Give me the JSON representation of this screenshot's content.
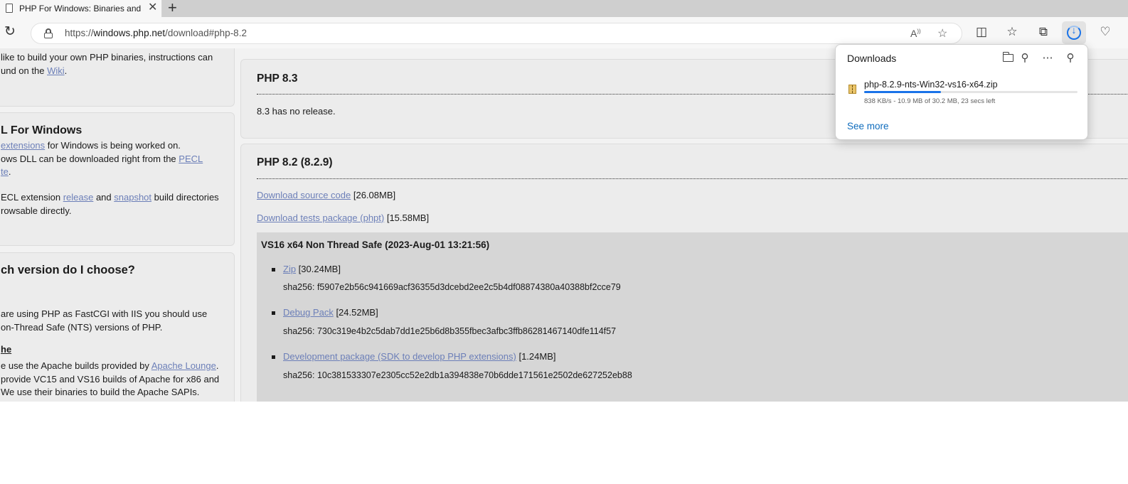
{
  "browser": {
    "tab": {
      "title": "PHP For Windows: Binaries and s",
      "close": "✕"
    },
    "new_tab": "+",
    "url": {
      "prefix": "https://",
      "host": "windows.php.net",
      "path": "/download#php-8.2"
    }
  },
  "downloads_flyout": {
    "title": "Downloads",
    "item": {
      "filename": "php-8.2.9-nts-Win32-vs16-x64.zip",
      "progress": 0.36,
      "status": "838 KB/s - 10.9 MB of 30.2 MB, 23 secs left"
    },
    "see_more": "See more"
  },
  "sidebar": {
    "build": {
      "line1": "like to build your own PHP binaries, instructions can",
      "line2_pre": "und on the ",
      "line2_link": "Wiki",
      "line2_post": "."
    },
    "pecl": {
      "title": "L For Windows",
      "line1_link": "extensions",
      "line1_post": " for Windows is being worked on.",
      "line2_pre": "ows DLL can be downloaded right from the ",
      "line2_link": "PECL",
      "line3_link": "te",
      "line3_post": ".",
      "line4_pre": "ECL extension ",
      "line4_link1": "release",
      "line4_mid": " and ",
      "line4_link2": "snapshot",
      "line4_post": " build directories",
      "line5": "rowsable directly."
    },
    "which": {
      "title": "ch version do I choose?",
      "line1": "are using PHP as FastCGI with IIS you should use",
      "line2": "on-Thread Safe (NTS) versions of PHP.",
      "apache_heading": "he",
      "line3_pre": "e use the Apache builds provided by ",
      "line3_link": "Apache Lounge",
      "line3_post": ".",
      "line4": "provide VC15 and VS16 builds of Apache for x86 and",
      "line5": "We use their binaries to build the Apache SAPIs."
    }
  },
  "main": {
    "php83": {
      "heading": "PHP 8.3",
      "text": "8.3 has no release."
    },
    "php82": {
      "heading": "PHP 8.2 (8.2.9)",
      "source_link": "Download source code",
      "source_size": " [26.08MB]",
      "tests_link": "Download tests package (phpt)",
      "tests_size": " [15.58MB]",
      "build_title": "VS16 x64 Non Thread Safe (2023-Aug-01 13:21:56)",
      "files": [
        {
          "link": "Zip",
          "size": " [30.24MB]",
          "sha": "sha256: f5907e2b56c941669acf36355d3dcebd2ee2c5b4df08874380a40388bf2cce79"
        },
        {
          "link": "Debug Pack",
          "size": " [24.52MB]",
          "sha": "sha256: 730c319e4b2c5dab7dd1e25b6d8b355fbec3afbc3ffb86281467140dfe114f57"
        },
        {
          "link": "Development package (SDK to develop PHP extensions)",
          "size": " [1.24MB]",
          "sha": "sha256: 10c381533307e2305cc52e2db1a394838e70b6dde171561e2502de627252eb88"
        }
      ]
    }
  }
}
